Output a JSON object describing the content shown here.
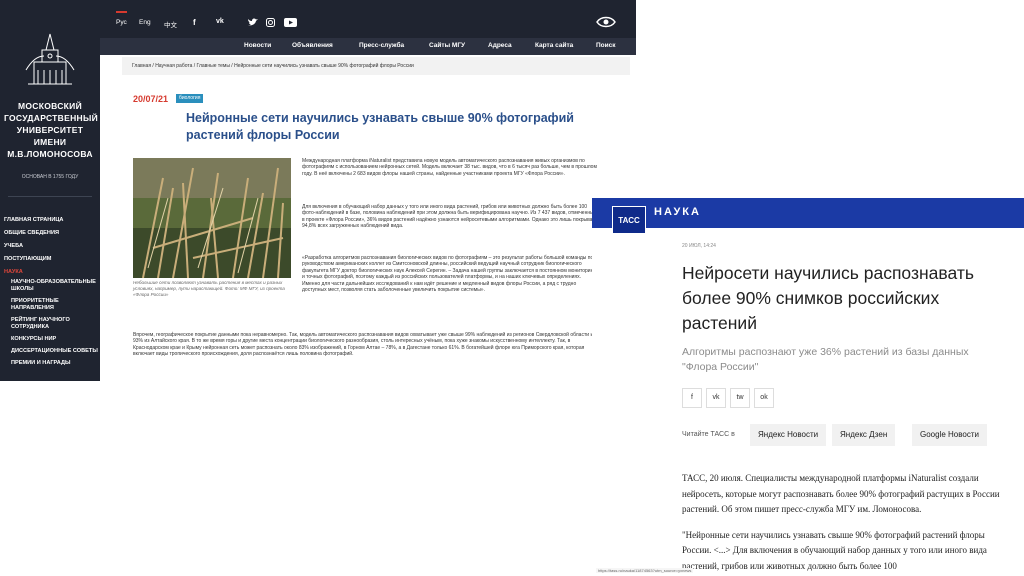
{
  "msu": {
    "sidebar": {
      "name_lines": [
        "МОСКОВСКИЙ",
        "ГОСУДАРСТВЕННЫЙ",
        "УНИВЕРСИТЕТ",
        "ИМЕНИ",
        "М.В.ЛОМОНОСОВА"
      ],
      "founded": "ОСНОВАН В 1755 ГОДУ",
      "nav": [
        "ГЛАВНАЯ СТРАНИЦА",
        "ОБЩИЕ СВЕДЕНИЯ",
        "УЧЕБА",
        "ПОСТУПАЮЩИМ",
        "НАУКА"
      ],
      "subnav": [
        "НАУЧНО-ОБРАЗОВАТЕЛЬНЫЕ ШКОЛЫ",
        "ПРИОРИТЕТНЫЕ НАПРАВЛЕНИЯ",
        "РЕЙТИНГ НАУЧНОГО СОТРУДНИКА",
        "КОНКУРСЫ НИР",
        "ДИССЕРТАЦИОННЫЕ СОВЕТЫ",
        "ПРЕМИИ И НАГРАДЫ"
      ]
    },
    "topbar": {
      "langs": [
        "Рус",
        "Eng",
        "中文"
      ],
      "socials": [
        "f",
        "vk",
        "tw",
        "ig",
        "yt"
      ]
    },
    "menu": [
      "Новости",
      "Объявления",
      "Пресс-служба",
      "Сайты МГУ",
      "Адреса",
      "Карта сайта",
      "Поиск"
    ],
    "breadcrumb": "Главная / Научная работа / Главные темы / Нейронные сети научились узнавать свыше 90% фотографий флоры России",
    "article": {
      "date": "20/07/21",
      "tag": "биология",
      "title": "Нейронные сети научились узнавать свыше 90% фотографий растений флоры России",
      "caption": "Небольшие сети позволяют узнавать растения в местах и разных условиях, например, пути нарастающей. Фото: МФ МГУ, из проекта «Флора России»",
      "p1": "Международная платформа iNaturalist представила новую модель автоматического распознавания живых организмов по фотографиям с использованием нейронных сетей. Модель включает 38 тыс. видов, что в 6 тысяч раз больше, чем в прошлом году. В неё включены 2 683 видов флоры нашей страны, найденные участниками проекта МГУ «Флора России».",
      "p2": "Для включения в обучающий набор данных у того или иного вида растений, грибов или животных должно быть более 100 фото-наблюдений в базе, половина наблюдений при этом должна быть верифицирована научно. Из 7 437 видов, отмеченных в проекте «Флора России», 36% видов растений надёжно узнаются нейросетевыми алгоритмами. Однако это лишь покрывает 94,8% всех загруженных наблюдений вида.",
      "p3": "«Разработка алгоритмов распознавания биологических видов по фотографиям – это результат работы большой команды под руководством американских коллег из Смитсоновской длинны, российский ведущий научный сотрудник биологического факультета МГУ доктор биологических наук Алексей Серегин. – Задача нашей группы заключается в постоянном мониторинге и точных фотографий, поэтому каждый из российских пользователей платформы, и на наших ключевых определениях. Именно для части дальнейших исследований к нам идёт решение и медленный видов флоры России, а ряд с трудно доступных мест, позволяя стать заболоченные увеличить покрытие системы».",
      "p4": "Впрочем, географическое покрытие данными пока неравномерно. Так, модель автоматического распознавания видов охватывает уже свыше 99% наблюдений из регионов Свердловской области и 93% из Алтайского края. В то же время горы и другие места концентрации биологического разнообразия, столь интересных учёным, пока хуже знакомы искусственному интеллекту. Так, в Краснодарском крае и Крыму нейронная сеть может распознать около 83% изображений, в Горном Алтае – 78%, а в Дагестане только 61%. В богатейшей флоре юга Приморского края, которая включает виды тропического происхождения, доля распознаётся лишь половина фотографий."
    }
  },
  "tass": {
    "section": "НАУКА",
    "logo": "ТАСС",
    "date": "20 ИЮЛ, 14:24",
    "title": "Нейросети научились распознавать более 90% снимков российских растений",
    "lead": "Алгоритмы распознают уже 36% растений из базы данных \"Флора России\"",
    "shares": [
      "f",
      "vk",
      "tw",
      "ok"
    ],
    "read_label": "Читайте ТАСС в",
    "read_buttons": [
      "Яндекс Новости",
      "Яндекс Дзен",
      "Google Новости"
    ],
    "body_p1": "ТАСС, 20 июля. Специалисты международной платформы iNaturalist создали нейросеть, которые могут распознавать более 90% фотографий растущих в России растений. Об этом пишет пресс-служба МГУ им. Ломоносова.",
    "body_p2": "\"Нейронные сети научились узнавать свыше 90% фотографий растений флоры России. <...> Для включения в обучающий набор данных у того или иного вида растений, грибов или животных должно быть более 100",
    "url_fragment": "https://tass.ru/nauka/11874563?utm_source=yxnews"
  },
  "colors": {
    "msu_dark": "#1f2430",
    "msu_red": "#d63a2f",
    "msu_title": "#2a4f8a",
    "tass_blue": "#1b3aa5"
  }
}
